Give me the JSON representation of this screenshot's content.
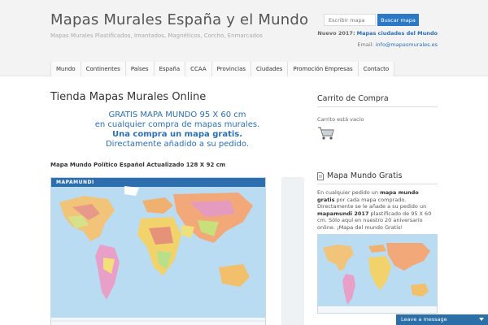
{
  "header": {
    "title": "Mapas Murales España y el Mundo",
    "description": "Mapas Murales Plastificados, Imantados, Magnéticos, Corcho, Enmarcados",
    "search_placeholder": "Escribir mapa",
    "search_button": "Buscar mapa",
    "promo_prefix": "Nuevo 2017:",
    "promo_link": "Mapas ciudades del Mundo",
    "email_prefix": "Email:",
    "email_link": "info@mapasmurales.es"
  },
  "nav": {
    "items": [
      "Mundo",
      "Continentes",
      "Países",
      "España",
      "CCAA",
      "Provincias",
      "Ciudades",
      "Promoción Empresas",
      "Contacto"
    ]
  },
  "main": {
    "title": "Tienda Mapas Murales Online",
    "offer_line1": "GRATIS MAPA MUNDO 95 X 60 cm",
    "offer_line2": "en cualquier compra de mapas murales.",
    "offer_line3": "Una compra un mapa gratis.",
    "offer_line4": "Directamente añadido a su pedido.",
    "map_caption": "Mapa Mundo Político Español Actualizado 128 X 92 cm",
    "map_label": "MAPAMUNDI"
  },
  "sidebar": {
    "cart_title": "Carrito de Compra",
    "cart_empty": "Carrito está vacío",
    "free_title": "Mapa Mundo Gratis",
    "free_text_1": "En cualquier pedido un ",
    "free_text_bold_1": "mapa mundo gratis",
    "free_text_2": " por cada mapa comprado. Directamente se le añade a su pedido un ",
    "free_text_bold_2": "mapamundi 2017",
    "free_text_3": " plastificado de 95 X 60 cm. Sólo aquí en nuestro 20 aniversario online. ¡Mapa del mundo Gratis!"
  },
  "chat": {
    "label": "Leave a message"
  },
  "colors": {
    "accent": "#2b6fb6",
    "button": "#2b78c6",
    "header_bg": "#f3f3f3",
    "ocean": "#b9dcf2"
  }
}
